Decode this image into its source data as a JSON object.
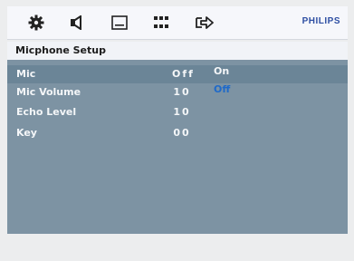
{
  "toolbar": {
    "icons": [
      "settings-gear-icon",
      "speaker-icon",
      "subtitle-icon",
      "grid-icon",
      "exit-icon"
    ],
    "brand": "PHILIPS"
  },
  "section": {
    "title": "Micphone Setup"
  },
  "settings": [
    {
      "label": "Mic",
      "value": "Off"
    },
    {
      "label": "Mic Volume",
      "value": "10"
    },
    {
      "label": "Echo Level",
      "value": "10"
    },
    {
      "label": "Key",
      "value": "00"
    }
  ],
  "options": [
    {
      "label": "On"
    },
    {
      "label": "Off"
    }
  ],
  "colors": {
    "panel": "#7d93a3",
    "highlight": "#6b8597",
    "selected_option": "#1f6ac9",
    "brand": "#2e4fa3"
  }
}
